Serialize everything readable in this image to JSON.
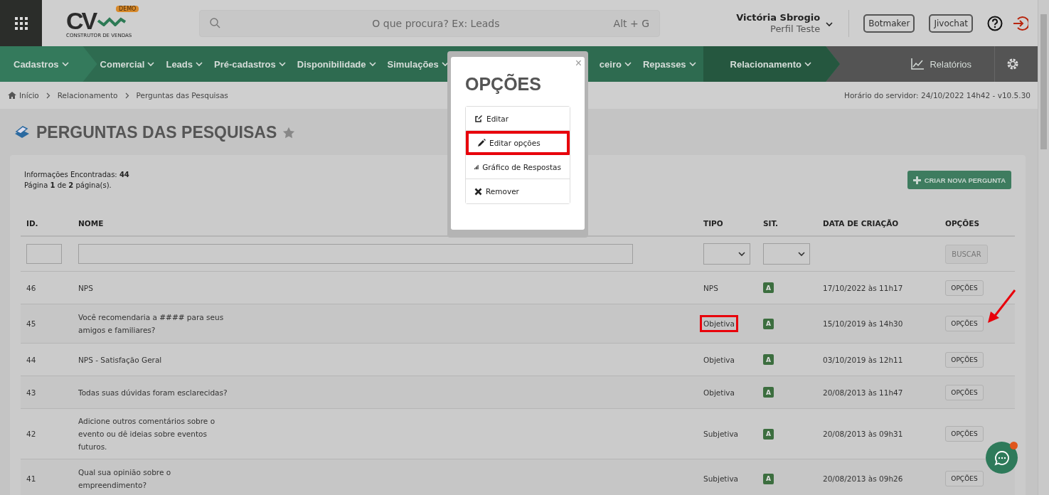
{
  "logo": {
    "letters": "CV",
    "badge": "DEMO",
    "tagline": "CONSTRUTOR DE VENDAS"
  },
  "search": {
    "placeholder": "O que procura? Ex: Leads",
    "shortcut": "Alt + G"
  },
  "user": {
    "name": "Victória Sbrogio",
    "profile": "Perfil Teste"
  },
  "top_buttons": [
    "Botmaker",
    "Jivochat"
  ],
  "nav": [
    {
      "label": "Cadastros",
      "kind": "segment"
    },
    {
      "label": "Comercial",
      "kind": "item"
    },
    {
      "label": "Leads",
      "kind": "item"
    },
    {
      "label": "Pré-cadastros",
      "kind": "item"
    },
    {
      "label": "Disponibilidade",
      "kind": "item"
    },
    {
      "label": "Simulações",
      "kind": "item"
    },
    {
      "label": "ceiro",
      "kind": "partial"
    },
    {
      "label": "Repasses",
      "kind": "item"
    },
    {
      "label": "Relacionamento",
      "kind": "segment"
    }
  ],
  "reports": "Relatórios",
  "breadcrumb": [
    "Início",
    "Relacionamento",
    "Perguntas das Pesquisas"
  ],
  "server_time": "Horário do servidor: 24/10/2022 14h42 - v10.5.30",
  "page_title": "PERGUNTAS DAS PESQUISAS",
  "info": {
    "found": "Informações Encontradas: **44**",
    "page": "Página **1** de **2** página(s)."
  },
  "create_button": "CRIAR NOVA PERGUNTA",
  "table": {
    "columns": [
      "ID.",
      "NOME",
      "TIPO",
      "SIT.",
      "DATA DE CRIAÇÃO",
      "OPÇÕES"
    ],
    "search_button": "BUSCAR",
    "rows": [
      {
        "id": "46",
        "name": [
          "NPS"
        ],
        "type": "NPS",
        "status": "A",
        "date": "17/10/2022 às 11h17",
        "button": "OPÇÕES",
        "highlighted": false,
        "pointer": false
      },
      {
        "id": "45",
        "name": [
          "Você recomendaria a #### para seus",
          "amigos e familiares?"
        ],
        "type": "Objetiva",
        "status": "A",
        "date": "15/10/2019 às 14h30",
        "button": "OPÇÕES",
        "highlighted": true,
        "pointer": true
      },
      {
        "id": "44",
        "name": [
          "NPS - Satisfação Geral"
        ],
        "type": "Objetiva",
        "status": "A",
        "date": "03/10/2019 às 12h11",
        "button": "OPÇÕES",
        "highlighted": false,
        "pointer": false
      },
      {
        "id": "43",
        "name": [
          "Todas suas dúvidas foram esclarecidas?"
        ],
        "type": "Objetiva",
        "status": "A",
        "date": "20/08/2013 às 11h47",
        "button": "OPÇÕES",
        "highlighted": false,
        "pointer": false
      },
      {
        "id": "42",
        "name": [
          "Adicione outros comentários sobre o",
          "evento ou dê ideias sobre eventos",
          "futuros."
        ],
        "type": "Subjetiva",
        "status": "A",
        "date": "20/08/2013 às 09h31",
        "button": "OPÇÕES",
        "highlighted": false,
        "pointer": false
      },
      {
        "id": "41",
        "name": [
          "Qual sua opinião sobre o",
          "empreendimento?"
        ],
        "type": "Subjetiva",
        "status": "A",
        "date": "20/08/2013 às 09h26",
        "button": "OPÇÕES",
        "highlighted": false,
        "pointer": false
      }
    ]
  },
  "modal": {
    "title": "OPÇÕES",
    "close": "×",
    "items": [
      {
        "label": "Editar",
        "kind": "edit",
        "highlighted": false
      },
      {
        "label": "Editar opções",
        "kind": "pencil",
        "highlighted": true
      },
      {
        "label": "Gráfico de Respostas",
        "kind": "chart",
        "highlighted": false
      },
      {
        "label": "Remover",
        "kind": "remove",
        "highlighted": false
      }
    ]
  }
}
